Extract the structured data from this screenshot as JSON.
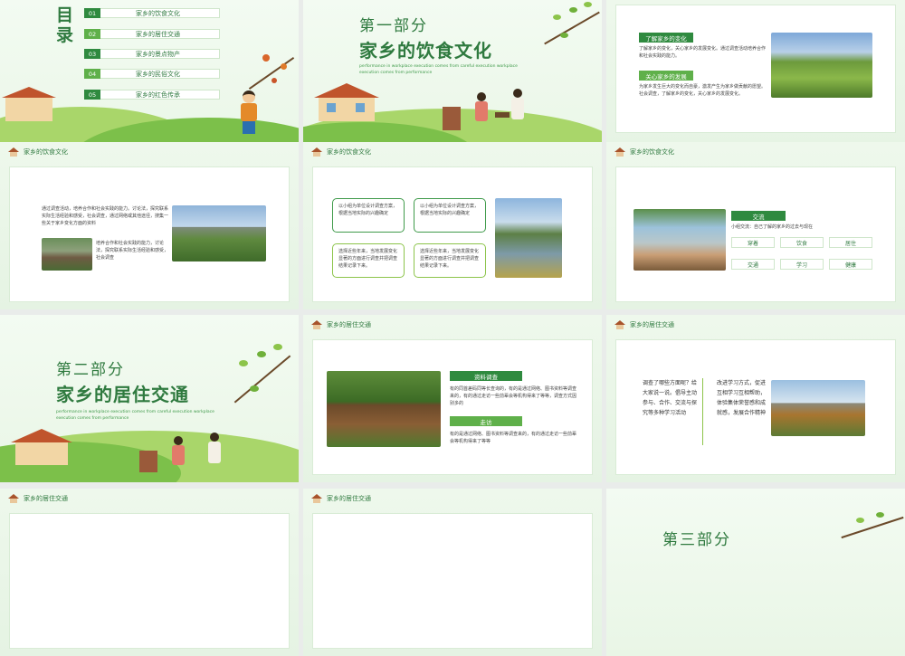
{
  "toc": {
    "title": "目录",
    "items": [
      {
        "num": "01",
        "label": "家乡的饮食文化"
      },
      {
        "num": "02",
        "label": "家乡的居住交通"
      },
      {
        "num": "03",
        "label": "家乡的景点物产"
      },
      {
        "num": "04",
        "label": "家乡的民俗文化"
      },
      {
        "num": "05",
        "label": "家乡的红色传承"
      }
    ]
  },
  "part1": {
    "num": "第一部分",
    "title": "家乡的饮食文化",
    "en1": "performance in workplace execution comes from careful execution workplace",
    "en2": "execution comes from performance"
  },
  "slide3": {
    "bar1": "了解家乡的变化",
    "text1": "了解家乡的变化，关心家乡的发展变化。通过调查活动培养合作和社会实践的能力。",
    "bar2": "关心家乡的发展",
    "text2": "为家乡发生巨大的变化而自豪，激发产生为家乡做贡献的愿望。社会调查，了解家乡的变化，关心家乡的发展变化。"
  },
  "section_food": "家乡的饮食文化",
  "section_traffic": "家乡的居住交通",
  "slide4": {
    "text1": "通过调查活动，培养合作和社会实践的能力。讨论法，探究联系实际生活经验和感受，社会调查，通过网络或其他途径，搜集一些关于家乡变化方面的资料",
    "text2": "培养合作和社会实践的能力，讨论法，探究联系实际生活经验和感受，社会调查"
  },
  "slide5": {
    "box1": "以小组为单位设计调查方案，根据当地实际的兴趣确定",
    "box2": "以小组为单位设计调查方案，根据当地实际的兴趣确定",
    "box3": "选择近些年来，当地发展变化显著的方面进行调查并把调查结果记录下来。",
    "box4": "选择近些年来，当地发展变化显著的方面进行调查并把调查结果记录下来。"
  },
  "slide6": {
    "bar": "交流",
    "desc": "小组交流：自己了解的家乡的过去与现在",
    "tags": [
      "穿着",
      "饮食",
      "居住",
      "交通",
      "学习",
      "健康"
    ]
  },
  "part2": {
    "num": "第二部分",
    "title": "家乡的居住交通",
    "en1": "performance in workplace execution comes from careful execution workplace",
    "en2": "execution comes from performance"
  },
  "slide8": {
    "bar1": "资料调查",
    "text1": "有的同首差码同等长查询的，有的是通过网络、图书资料等调查来的，有的通过走访一些前辈会等机构得来了等等，调查方式因别多的",
    "bar2": "走访",
    "text2": "有的是通过网络、图书资料等调查来的，有的通过走访一些前辈会等机构得来了等等"
  },
  "slide9": {
    "left": "调查了哪些方面呢？给大家说一说。倡导主动参与、合作、交流与探究等多种学习活动",
    "right": "改进学习方式，促进互相学习互相帮助，体验集体荣誉感和成就感，发展合作精神"
  },
  "part3": {
    "num": "第三部分"
  },
  "colors": {
    "primary": "#2f8a3f",
    "text": "#2f7a3f",
    "bg": "#eef8ec"
  }
}
